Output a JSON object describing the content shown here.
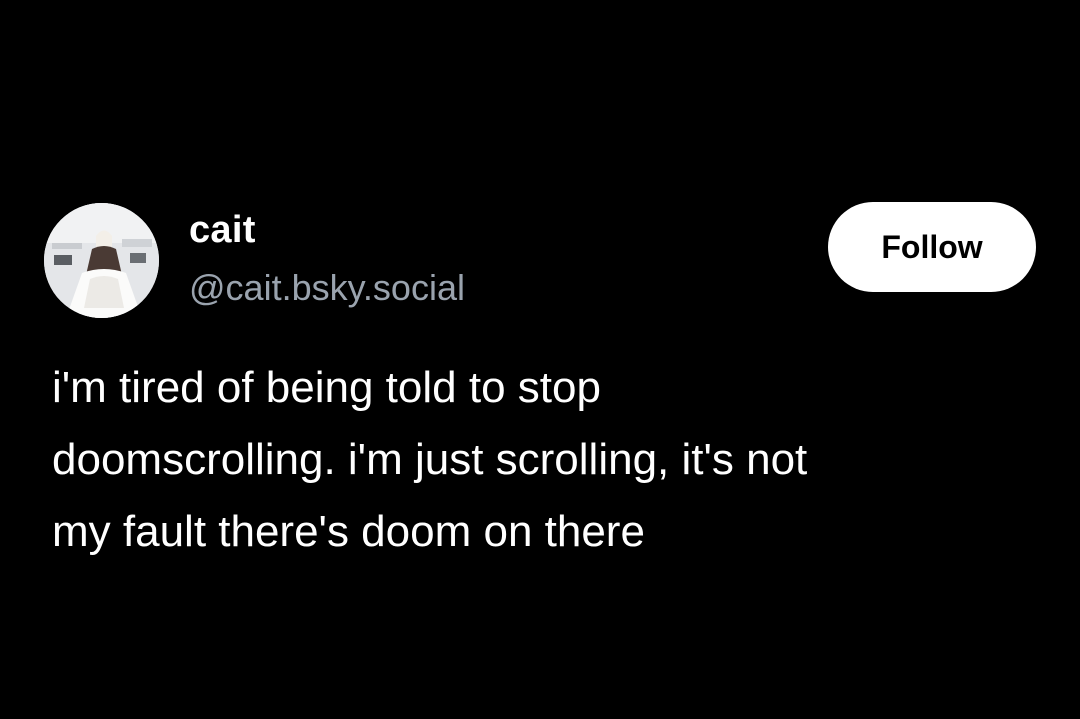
{
  "author": {
    "display_name": "cait",
    "handle": "@cait.bsky.social",
    "avatar": "profile-photo"
  },
  "actions": {
    "follow_label": "Follow"
  },
  "post": {
    "lines": [
      "i'm tired of being told to stop",
      "doomscrolling. i'm just scrolling, it's not",
      "my fault there's doom on there"
    ]
  },
  "colors": {
    "background": "#000000",
    "text": "#ffffff",
    "handle": "#9aa3ae",
    "button_bg": "#ffffff",
    "button_text": "#000000"
  }
}
